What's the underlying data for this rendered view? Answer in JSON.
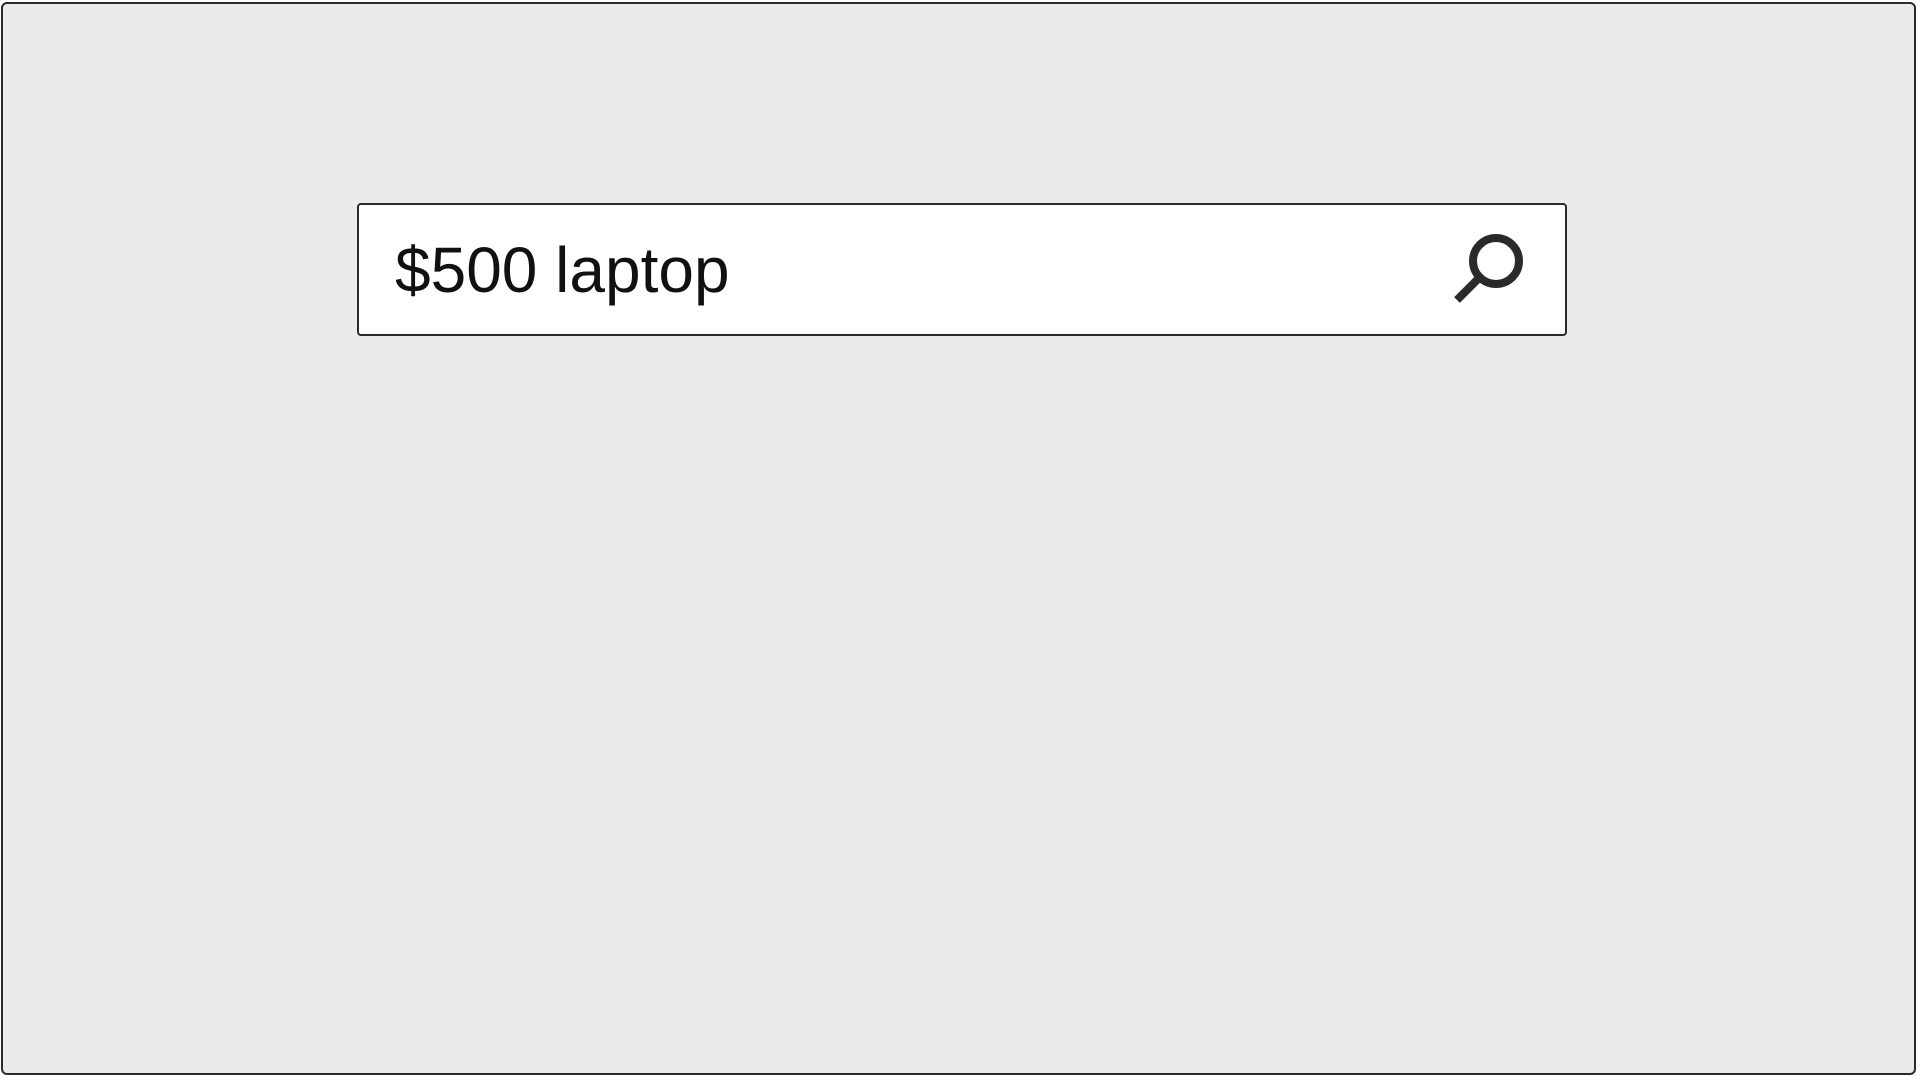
{
  "search": {
    "value": "$500 laptop",
    "icon": "search-icon"
  },
  "colors": {
    "background": "#ebebeb",
    "border": "#2a2a2a",
    "input_background": "#ffffff",
    "text": "#111111",
    "icon": "#2a2a2a"
  }
}
